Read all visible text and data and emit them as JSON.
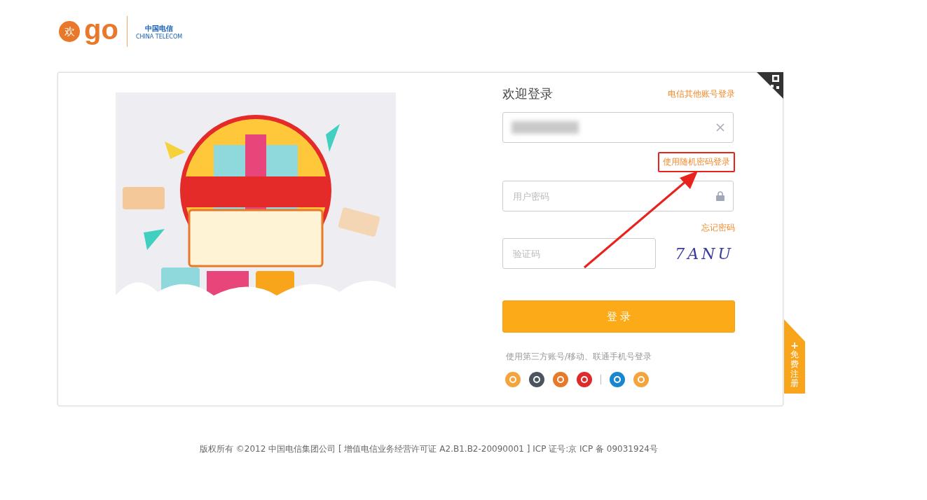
{
  "logo": {
    "mark": "欢",
    "word": "go",
    "partner": "中国电信",
    "partner_en": "CHINA TELECOM"
  },
  "login": {
    "title": "欢迎登录",
    "other_account_link": "电信其他账号登录",
    "username": {
      "redacted": true
    },
    "random_password_link": {
      "text": "使用随机密码登录",
      "highlighted": true
    },
    "password": {
      "placeholder": "用户密码"
    },
    "forgot_link": "忘记密码",
    "captcha": {
      "placeholder": "验证码",
      "code": "7ANU"
    },
    "submit": "登 录",
    "third_party_hint": "使用第三方账号/移动、联通手机号登录",
    "providers": [
      {
        "kind": "snail",
        "color": "#f5a43c"
      },
      {
        "kind": "alipay",
        "color": "#4a5560"
      },
      {
        "kind": "weibo",
        "color": "#e8792a"
      },
      {
        "kind": "yi",
        "color": "#e02a2a"
      },
      {
        "kind": "divider"
      },
      {
        "kind": "cmcc",
        "color": "#1a86d0"
      },
      {
        "kind": "unicom",
        "color": "#f5a43c"
      }
    ]
  },
  "register_tab": {
    "icon": "+",
    "label": "免费注册"
  },
  "footer": "版权所有 ©2012 中国电信集团公司 [ 增值电信业务经营许可证 A2.B1.B2-20090001 ] ICP 证号:京 ICP 备 09031924号"
}
